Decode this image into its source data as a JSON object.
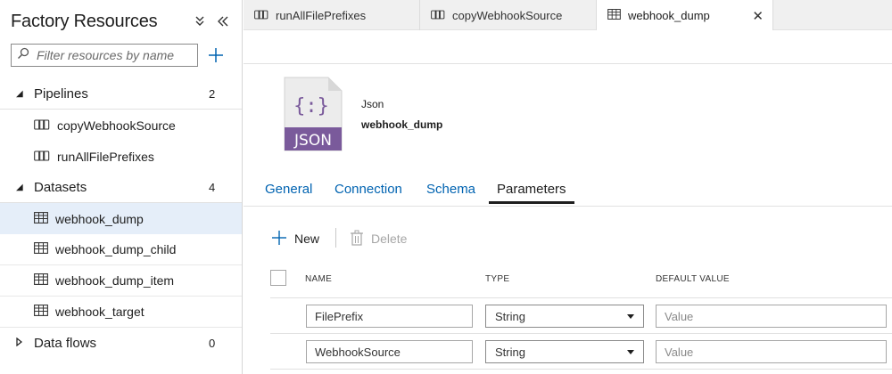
{
  "sidebar": {
    "title": "Factory Resources",
    "filter_placeholder": "Filter resources by name",
    "groups": [
      {
        "label": "Pipelines",
        "count": "2",
        "items": [
          "copyWebhookSource",
          "runAllFilePrefixes"
        ]
      },
      {
        "label": "Datasets",
        "count": "4",
        "items": [
          "webhook_dump",
          "webhook_dump_child",
          "webhook_dump_item",
          "webhook_target"
        ]
      },
      {
        "label": "Data flows",
        "count": "0",
        "items": []
      }
    ],
    "selected_item": "webhook_dump"
  },
  "tabs": [
    {
      "label": "runAllFilePrefixes",
      "icon": "pipeline-icon"
    },
    {
      "label": "copyWebhookSource",
      "icon": "pipeline-icon"
    },
    {
      "label": "webhook_dump",
      "icon": "dataset-icon",
      "active": true
    }
  ],
  "dataset": {
    "format": "Json",
    "name": "webhook_dump",
    "icon_label": "JSON",
    "icon_glyph": "{:}"
  },
  "subtabs": [
    "General",
    "Connection",
    "Schema",
    "Parameters"
  ],
  "active_subtab": "Parameters",
  "actions": {
    "new": "New",
    "delete": "Delete"
  },
  "table": {
    "headers": {
      "name": "NAME",
      "type": "TYPE",
      "default": "DEFAULT VALUE"
    },
    "rows": [
      {
        "name": "FilePrefix",
        "type": "String",
        "default_placeholder": "Value"
      },
      {
        "name": "WebhookSource",
        "type": "String",
        "default_placeholder": "Value"
      }
    ]
  },
  "colors": {
    "accent": "#0063b1",
    "selected": "#e5eef9",
    "json_purple": "#7a5a9b"
  }
}
